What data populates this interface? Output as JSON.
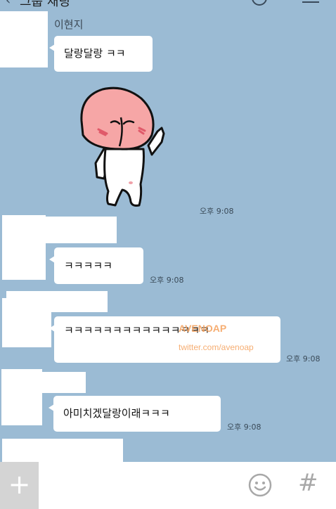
{
  "header": {
    "back_glyph": "‹",
    "title": "그룹 채팅"
  },
  "messages": [
    {
      "sender": "이현지",
      "text": "달랑달랑 ㅋㅋ"
    },
    {
      "sticker": "peach-sticker",
      "time": "오후 9:08"
    },
    {
      "text": "ㅋㅋㅋㅋㅋ",
      "time": "오후 9:08"
    },
    {
      "text": "ㅋㅋㅋㅋㅋㅋㅋㅋㅋㅋㅋㅋㅋㅋㅋ",
      "time": "오후 9:08"
    },
    {
      "text": "아미치겠달랑이래ㅋㅋㅋ",
      "time": "오후 9:08"
    }
  ],
  "watermark": {
    "line1": "AVENOAP",
    "line2": "twitter.com/avenoap"
  },
  "bottombar": {
    "plus_glyph": "+",
    "hash_glyph": "#"
  },
  "colors": {
    "background": "#9bbbd4",
    "bubble": "#ffffff",
    "peach": "#f6a6a6"
  },
  "icons": [
    "back-icon",
    "search-icon",
    "menu-icon",
    "plus-icon",
    "emoticon-icon",
    "hash-icon"
  ]
}
